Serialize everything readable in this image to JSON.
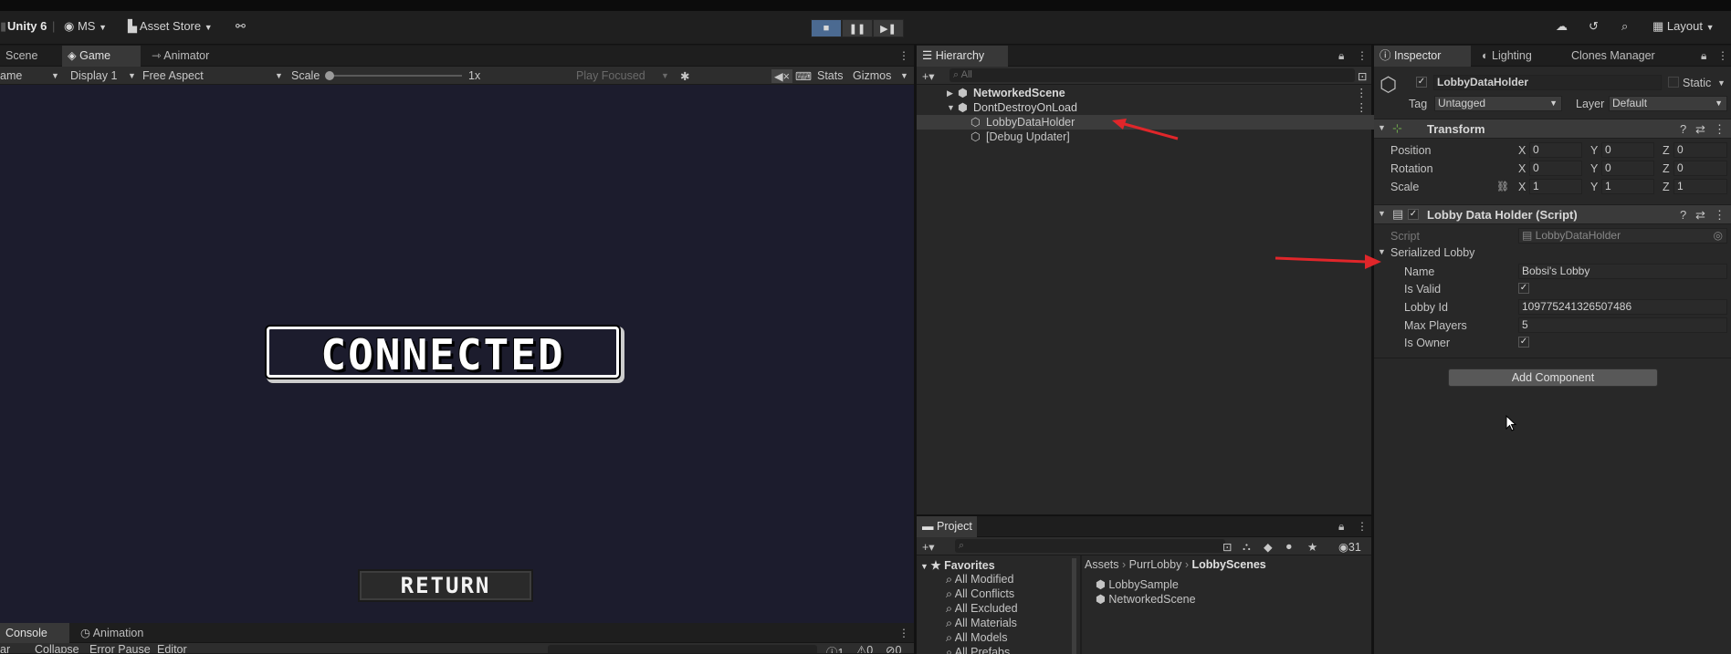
{
  "toolbar": {
    "app_label": "Unity 6",
    "account_label": "MS",
    "asset_store_label": "Asset Store",
    "layout_label": "Layout"
  },
  "game_panel": {
    "tabs": [
      "Scene",
      "Game",
      "Animator"
    ],
    "subbar": {
      "mode_value": "ame",
      "display_value": "Display 1",
      "aspect_value": "Free Aspect",
      "scale_label": "Scale",
      "scale_value": "1x",
      "play_focus_value": "Play Focused",
      "stats_label": "Stats",
      "gizmos_label": "Gizmos"
    },
    "connected_text": "CONNECTED",
    "return_label": "RETURN"
  },
  "console_panel": {
    "tabs": [
      "Console",
      "Animation"
    ],
    "subbar": {
      "clear_label": "ar",
      "collapse_label": "Collapse",
      "error_pause_label": "Error Pause",
      "editor_label": "Editor",
      "count_info": "1",
      "count_warn": "0",
      "count_error": "0"
    }
  },
  "hierarchy": {
    "tab_label": "Hierarchy",
    "search_placeholder": "All",
    "items": [
      {
        "label": "NetworkedScene"
      },
      {
        "label": "DontDestroyOnLoad"
      },
      {
        "label": "LobbyDataHolder"
      },
      {
        "label": "[Debug Updater]"
      }
    ]
  },
  "project": {
    "tab_label": "Project",
    "hidden_count": "31",
    "favorites_label": "Favorites",
    "favorites": [
      "All Modified",
      "All Conflicts",
      "All Excluded",
      "All Materials",
      "All Models",
      "All Prefabs"
    ],
    "breadcrumb": [
      "Assets",
      "PurrLobby",
      "LobbyScenes"
    ],
    "files": [
      "LobbySample",
      "NetworkedScene"
    ]
  },
  "inspector": {
    "tabs": [
      "Inspector",
      "Lighting",
      "Clones Manager"
    ],
    "object_name": "LobbyDataHolder",
    "static_label": "Static",
    "tag_label": "Tag",
    "tag_value": "Untagged",
    "layer_label": "Layer",
    "layer_value": "Default",
    "transform": {
      "title": "Transform",
      "rows": [
        {
          "label": "Position",
          "x": "0",
          "y": "0",
          "z": "0"
        },
        {
          "label": "Rotation",
          "x": "0",
          "y": "0",
          "z": "0"
        },
        {
          "label": "Scale",
          "x": "1",
          "y": "1",
          "z": "1"
        }
      ],
      "axis_x": "X",
      "axis_y": "Y",
      "axis_z": "Z"
    },
    "script_component": {
      "title": "Lobby Data Holder (Script)",
      "script_label": "Script",
      "script_value": "LobbyDataHolder",
      "serialized_label": "Serialized Lobby",
      "name_label": "Name",
      "name_value": "Bobsi's Lobby",
      "is_valid_label": "Is Valid",
      "is_valid": true,
      "lobby_id_label": "Lobby Id",
      "lobby_id_value": "109775241326507486",
      "max_players_label": "Max Players",
      "max_players_value": "5",
      "is_owner_label": "Is Owner",
      "is_owner": true
    },
    "add_component_label": "Add Component"
  },
  "colors": {
    "annotation_arrow": "#e0262a",
    "game_background": "#1c1c2d",
    "play_active": "#4b6a91"
  }
}
